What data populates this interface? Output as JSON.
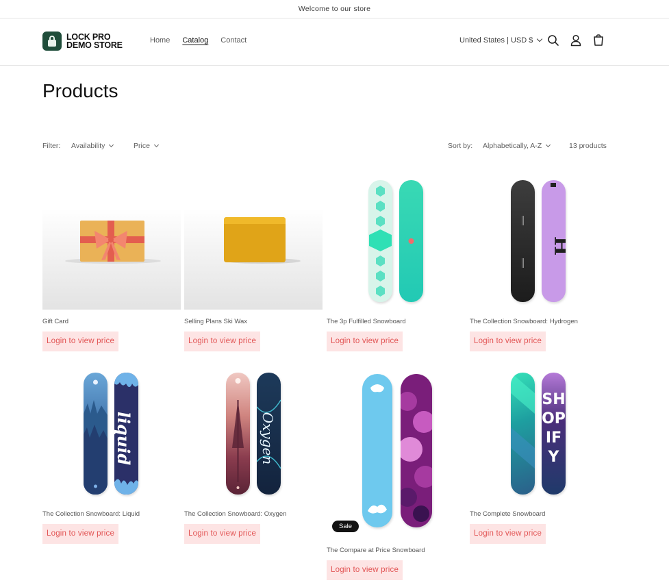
{
  "announcement": "Welcome to our store",
  "header": {
    "logo_line1": "LOCK PRO",
    "logo_line2": "DEMO STORE",
    "nav": [
      "Home",
      "Catalog",
      "Contact"
    ],
    "active_nav": "Catalog",
    "locale": "United States | USD $",
    "icons": [
      "search-icon",
      "account-icon",
      "cart-icon"
    ]
  },
  "page_title": "Products",
  "facets": {
    "filter_label": "Filter:",
    "availability": "Availability",
    "price": "Price",
    "sort_label": "Sort by:",
    "sort_value": "Alphabetically, A-Z",
    "count": "13 products"
  },
  "price_button_label": "Login to view price",
  "sale_label": "Sale",
  "products": [
    {
      "title": "Gift Card"
    },
    {
      "title": "Selling Plans Ski Wax"
    },
    {
      "title": "The 3p Fulfilled Snowboard"
    },
    {
      "title": "The Collection Snowboard: Hydrogen"
    },
    {
      "title": "The Collection Snowboard: Liquid"
    },
    {
      "title": "The Collection Snowboard: Oxygen"
    },
    {
      "title": "The Compare at Price Snowboard",
      "sale": true
    },
    {
      "title": "The Complete Snowboard"
    }
  ],
  "board_art": {
    "hydrogen": "H",
    "liquid": "liquid",
    "oxygen": "Oxygen",
    "complete": "SHOPIFY"
  },
  "colors": {
    "price_bg": "#fde4e4",
    "price_text": "#e25555",
    "logo_green": "#1f4d3a",
    "sale_badge": "#121212"
  }
}
